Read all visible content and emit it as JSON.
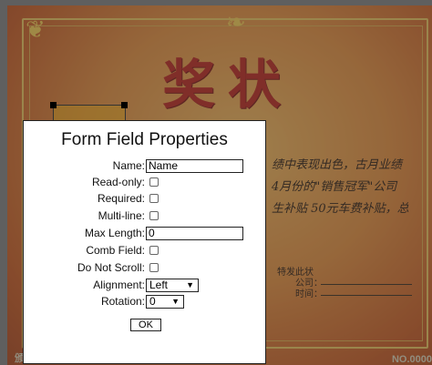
{
  "certificate": {
    "title": "奖状",
    "body_lines": [
      "绩中表现出色，古月业绩",
      "4月份的\"销售冠军\"公司",
      "生补贴 50元车费补贴，总"
    ],
    "footer_lines": [
      "特发此状",
      "公司：",
      "时间："
    ],
    "left_text": "颁",
    "number": "NO.0000"
  },
  "dialog": {
    "title": "Form Field Properties",
    "fields": [
      {
        "label": "Name:",
        "type": "text",
        "value": "Name"
      },
      {
        "label": "Read-only:",
        "type": "checkbox"
      },
      {
        "label": "Required:",
        "type": "checkbox"
      },
      {
        "label": "Multi-line:",
        "type": "checkbox"
      },
      {
        "label": "Max Length:",
        "type": "text",
        "value": "0"
      },
      {
        "label": "Comb Field:",
        "type": "checkbox"
      },
      {
        "label": "Do Not Scroll:",
        "type": "checkbox"
      },
      {
        "label": "Alignment:",
        "type": "select",
        "value": "Left"
      },
      {
        "label": "Rotation:",
        "type": "select",
        "value": "0"
      }
    ],
    "ok_label": "OK",
    "dropdown_arrow": "▼"
  }
}
